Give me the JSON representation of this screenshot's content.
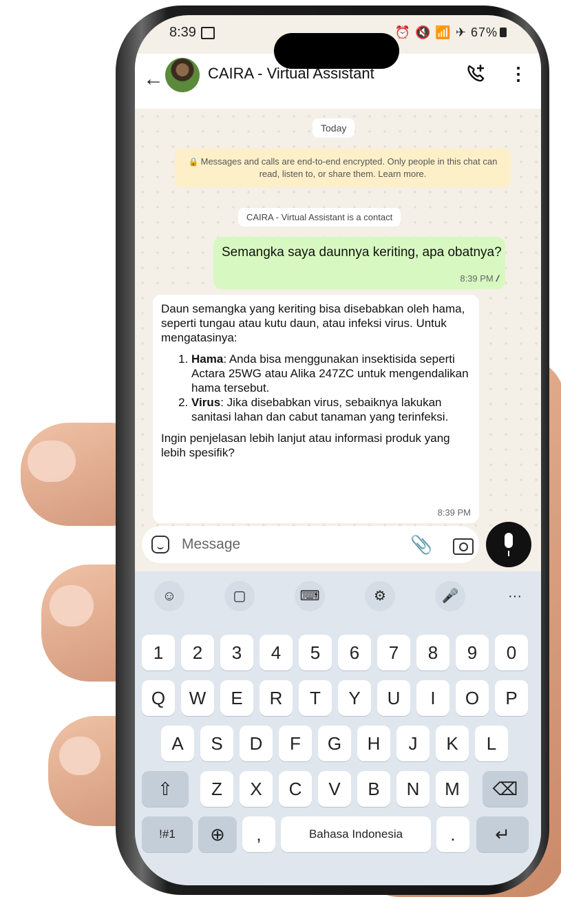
{
  "status_bar": {
    "time": "8:39",
    "battery": "67%"
  },
  "header": {
    "contact_name": "CAIRA - Virtual Assistant"
  },
  "chat": {
    "date_label": "Today",
    "encryption_notice": "Messages and calls are end-to-end encrypted. Only people in this chat can read, listen to, or share them. Learn more.",
    "contact_notice": "CAIRA - Virtual Assistant is a contact",
    "sent": {
      "text": "Semangka saya daunnya keriting, apa obatnya?",
      "time": "8:39 PM"
    },
    "received": {
      "intro": "Daun semangka yang keriting bisa disebabkan oleh hama, seperti tungau atau kutu daun, atau infeksi virus. Untuk mengatasinya:",
      "items": [
        {
          "title": "Hama",
          "text": ": Anda bisa menggunakan insektisida seperti Actara 25WG atau Alika 247ZC untuk mengendalikan hama tersebut."
        },
        {
          "title": "Virus",
          "text": ": Jika disebabkan virus, sebaiknya lakukan sanitasi lahan dan cabut tanaman yang terinfeksi."
        }
      ],
      "outro": "Ingin penjelasan lebih lanjut atau informasi produk yang lebih spesifik?",
      "time": "8:39 PM"
    }
  },
  "composer": {
    "placeholder": "Message"
  },
  "keyboard": {
    "more_label": "···",
    "number_row": [
      "1",
      "2",
      "3",
      "4",
      "5",
      "6",
      "7",
      "8",
      "9",
      "0"
    ],
    "row1": [
      "Q",
      "W",
      "E",
      "R",
      "T",
      "Y",
      "U",
      "I",
      "O",
      "P"
    ],
    "row2": [
      "A",
      "S",
      "D",
      "F",
      "G",
      "H",
      "J",
      "K",
      "L"
    ],
    "row3": [
      "Z",
      "X",
      "C",
      "V",
      "B",
      "N",
      "M"
    ],
    "symbols_label": "!#1",
    "comma_label": ",",
    "space_label": "Bahasa Indonesia",
    "period_label": "."
  }
}
